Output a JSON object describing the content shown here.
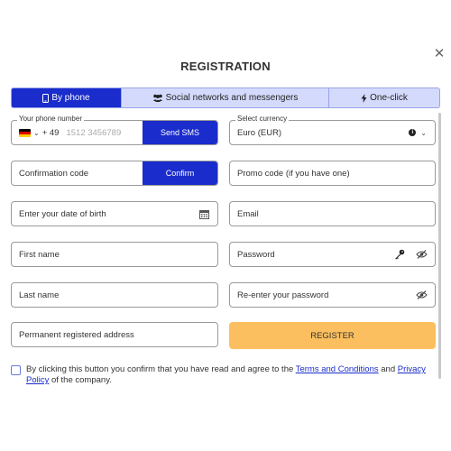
{
  "dialog": {
    "title": "REGISTRATION",
    "close_symbol": "✕"
  },
  "tabs": [
    {
      "label": "By phone",
      "icon": "phone-icon",
      "active": true
    },
    {
      "label": "Social networks and messengers",
      "icon": "users-icon",
      "active": false
    },
    {
      "label": "One-click",
      "icon": "lightning-icon",
      "active": false
    }
  ],
  "phone": {
    "legend": "Your phone number",
    "country_code": "+ 49",
    "placeholder": "1512 3456789",
    "button": "Send SMS"
  },
  "currency": {
    "legend": "Select currency",
    "value": "Euro (EUR)"
  },
  "confirmation": {
    "placeholder": "Confirmation code",
    "button": "Confirm"
  },
  "promo": {
    "placeholder": "Promo code (if you have one)"
  },
  "dob": {
    "placeholder": "Enter your date of birth"
  },
  "email": {
    "placeholder": "Email"
  },
  "first_name": {
    "placeholder": "First name"
  },
  "password": {
    "placeholder": "Password"
  },
  "last_name": {
    "placeholder": "Last name"
  },
  "repeat_password": {
    "placeholder": "Re-enter your password"
  },
  "address": {
    "placeholder": "Permanent registered address"
  },
  "register_button": "REGISTER",
  "agreement": {
    "prefix": "By clicking this button you confirm that you have read and agree to the ",
    "terms_link": "Terms and Conditions",
    "middle": " and ",
    "privacy_link": "Privacy Policy",
    "suffix": " of the company."
  },
  "colors": {
    "accent": "#1a2ccc",
    "tab_bg": "#d4dafc",
    "register": "#fbbf5f"
  }
}
